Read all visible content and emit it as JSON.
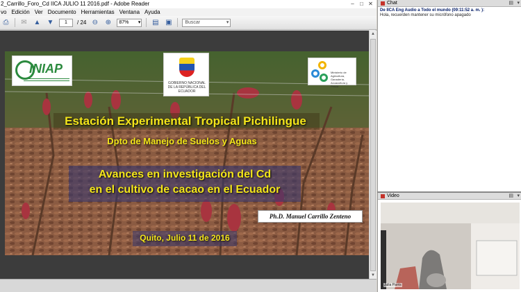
{
  "window": {
    "title": "2_Carrillo_Foro_Cd IICA JULIO 11 2016.pdf - Adobe Reader"
  },
  "menu": [
    "vo",
    "Edición",
    "Ver",
    "Documento",
    "Herramientas",
    "Ventana",
    "Ayuda"
  ],
  "toolbar": {
    "page_current": "1",
    "page_total": "/ 24",
    "zoom": "87%",
    "search_placeholder": "Buscar"
  },
  "slide": {
    "logo_left_text": "INIAP",
    "logo_center_caption": "GOBIERNO NACIONAL DE LA REPÚBLICA DEL ECUADOR",
    "logo_right_caption": "Ministerio de Agricultura, Ganadería, Acuacultura y Pesca",
    "title": "Estación Experimental Tropical Pichilingue",
    "subtitle": "Dpto de Manejo de Suelos y Aguas",
    "headline_line1": "Avances en investigación del Cd",
    "headline_line2": "en el cultivo de cacao en el Ecuador",
    "author": "Ph.D. Manuel Carrillo Zenteno",
    "date": "Quito, Julio 11 de 2016"
  },
  "chat": {
    "header": "Chat",
    "message_from": "De IICA Eng Audio a Todo el mundo (09:11:52 a. m. ):",
    "message_text": "Hola, recuerden mantener su micrófono apagado"
  },
  "video": {
    "header": "Video",
    "participant": "Julia Parris"
  },
  "colors": {
    "slide_text": "#f3e51a",
    "reader_bg": "#3c3c3c"
  }
}
